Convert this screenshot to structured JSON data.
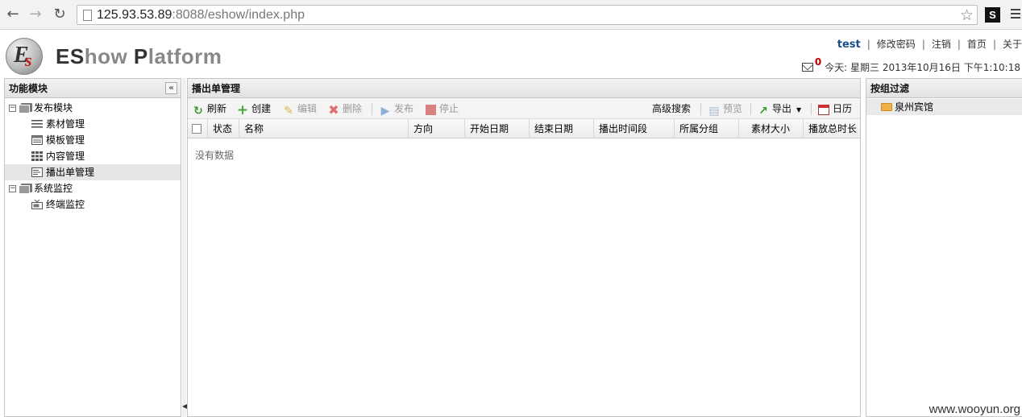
{
  "browser": {
    "url_host": "125.93.53.89",
    "url_rest": ":8088/eshow/index.php",
    "extension_label": "S"
  },
  "header": {
    "brand_es": "ES",
    "brand_how": "how",
    "brand_p": "P",
    "brand_latform": "latform",
    "user": "test",
    "links": [
      "修改密码",
      "注销",
      "首页",
      "关于"
    ],
    "message_count": "0",
    "date_text": "今天: 星期三 2013年10月16日 下午1:10:18"
  },
  "left_panel": {
    "title": "功能模块",
    "tree": [
      {
        "label": "发布模块",
        "children": [
          "素材管理",
          "模板管理",
          "内容管理",
          "播出单管理"
        ]
      },
      {
        "label": "系统监控",
        "children": [
          "终端监控"
        ]
      }
    ]
  },
  "center_panel": {
    "title": "播出单管理",
    "toolbar": {
      "refresh": "刷新",
      "create": "创建",
      "edit": "编辑",
      "delete": "删除",
      "publish": "发布",
      "stop": "停止",
      "advanced_search": "高级搜索",
      "preview": "预览",
      "export": "导出",
      "calendar": "日历"
    },
    "columns": [
      "状态",
      "名称",
      "方向",
      "开始日期",
      "结束日期",
      "播出时间段",
      "所属分组",
      "素材大小",
      "播放总时长"
    ],
    "empty_text": "没有数据"
  },
  "right_panel": {
    "title": "按组过滤",
    "groups": [
      "泉州宾馆"
    ]
  },
  "watermark": "www.wooyun.org"
}
